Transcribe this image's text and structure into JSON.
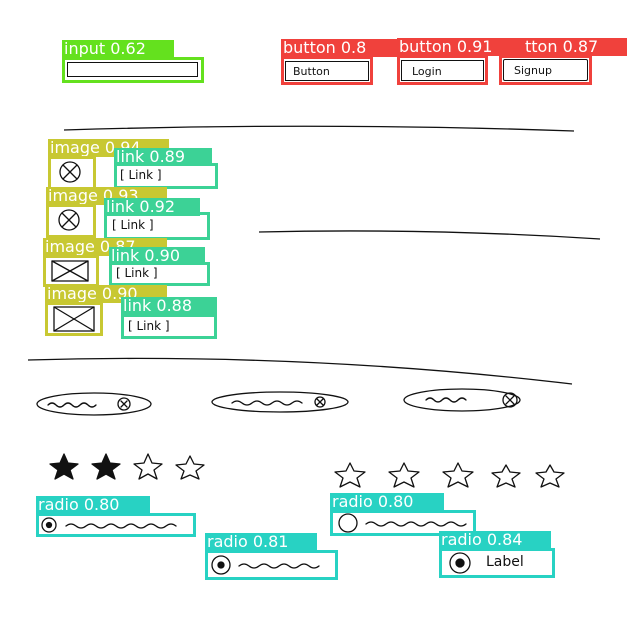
{
  "colors": {
    "input": "#64e11e",
    "button": "#f0413c",
    "image": "#c8c832",
    "link": "#3cd296",
    "radio": "#28d2c3",
    "ink": "#111111"
  },
  "detections": {
    "input": {
      "label": "input 0.62"
    },
    "buttons": [
      {
        "label": "button 0.8",
        "text": "Button"
      },
      {
        "label": "button 0.91",
        "text": "Login"
      },
      {
        "label": "tton 0.87",
        "text": "Signup"
      }
    ],
    "images": [
      {
        "label": "image 0.94"
      },
      {
        "label": "image 0.93"
      },
      {
        "label": "image 0.87"
      },
      {
        "label": "image 0.90"
      }
    ],
    "links": [
      {
        "label": "link 0.89",
        "text": "[ Link ]"
      },
      {
        "label": "link 0.92",
        "text": "[ Link ]"
      },
      {
        "label": "link 0.90",
        "text": "[ Link ]"
      },
      {
        "label": "link 0.88",
        "text": "[ Link ]"
      }
    ],
    "radios": [
      {
        "label": "radio 0.80"
      },
      {
        "label": "radio 0.81"
      },
      {
        "label": "radio 0.80"
      },
      {
        "label": "radio 0.84",
        "text": "Label"
      }
    ]
  },
  "rating_left": {
    "filled": 2,
    "total": 4
  },
  "rating_right": {
    "filled": 0,
    "total": 5
  }
}
